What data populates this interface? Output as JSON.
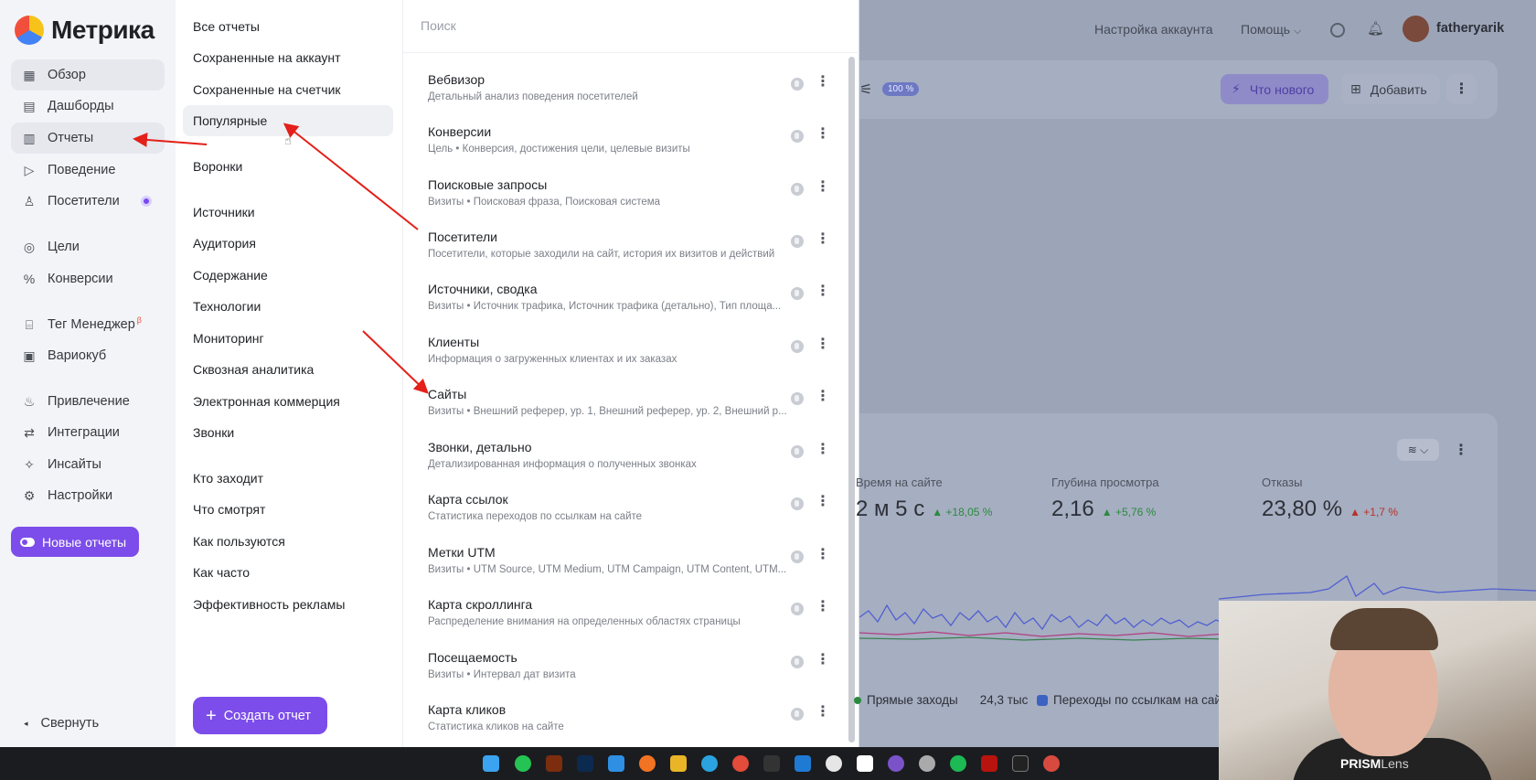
{
  "logo": {
    "text": "Метрика"
  },
  "leftnav": {
    "items": [
      {
        "label": "Обзор",
        "icon": "grid-icon"
      },
      {
        "label": "Дашборды",
        "icon": "dashboard-icon"
      },
      {
        "label": "Отчеты",
        "icon": "bar-chart-icon"
      },
      {
        "label": "Поведение",
        "icon": "play-icon"
      },
      {
        "label": "Посетители",
        "icon": "user-icon"
      },
      {
        "label": "Цели",
        "icon": "target-icon"
      },
      {
        "label": "Конверсии",
        "icon": "percent-icon"
      },
      {
        "label": "Тег Менеджер",
        "icon": "tag-icon",
        "badge": "β"
      },
      {
        "label": "Вариокуб",
        "icon": "cube-icon"
      },
      {
        "label": "Привлечение",
        "icon": "fire-icon"
      },
      {
        "label": "Интеграции",
        "icon": "integrations-icon"
      },
      {
        "label": "Инсайты",
        "icon": "sparkle-icon"
      },
      {
        "label": "Настройки",
        "icon": "gear-icon"
      }
    ],
    "new_reports": "Новые отчеты",
    "collapse": "Свернуть"
  },
  "categories": {
    "items": [
      "Все отчеты",
      "Сохраненные на аккаунт",
      "Сохраненные на счетчик",
      "Популярные",
      "Воронки",
      "Источники",
      "Аудитория",
      "Содержание",
      "Технологии",
      "Мониторинг",
      "Сквозная аналитика",
      "Электронная коммерция",
      "Звонки",
      "Кто заходит",
      "Что смотрят",
      "Как пользуются",
      "Как часто",
      "Эффективность рекламы"
    ],
    "create_button": "Создать отчет"
  },
  "reports": {
    "search_placeholder": "Поиск",
    "items": [
      {
        "title": "Вебвизор",
        "desc": "Детальный анализ поведения посетителей"
      },
      {
        "title": "Конверсии",
        "desc": "Цель • Конверсия, достижения цели, целевые визиты"
      },
      {
        "title": "Поисковые запросы",
        "desc": "Визиты • Поисковая фраза, Поисковая система"
      },
      {
        "title": "Посетители",
        "desc": "Посетители, которые заходили на сайт, история их визитов и действий"
      },
      {
        "title": "Источники, сводка",
        "desc": "Визиты • Источник трафика, Источник трафика (детально), Тип площа..."
      },
      {
        "title": "Клиенты",
        "desc": "Информация о загруженных клиентах и их заказах"
      },
      {
        "title": "Сайты",
        "desc": "Визиты • Внешний реферер, ур. 1, Внешний реферер, ур. 2, Внешний р..."
      },
      {
        "title": "Звонки, детально",
        "desc": "Детализированная информация о полученных звонках"
      },
      {
        "title": "Карта ссылок",
        "desc": "Статистика переходов по ссылкам на сайте"
      },
      {
        "title": "Метки UTM",
        "desc": "Визиты • UTM Source, UTM Medium, UTM Campaign, UTM Content, UTM..."
      },
      {
        "title": "Карта скроллинга",
        "desc": "Распределение внимания на определенных областях страницы"
      },
      {
        "title": "Посещаемость",
        "desc": "Визиты • Интервал дат визита"
      },
      {
        "title": "Карта кликов",
        "desc": "Статистика кликов на сайте"
      }
    ]
  },
  "topbar": {
    "account_settings": "Настройка аккаунта",
    "help": "Помощь",
    "username": "fatheryarik"
  },
  "toolbar": {
    "chip": "100 %",
    "whats_new": "Что нового",
    "add": "Добавить"
  },
  "metrics": [
    {
      "label": "Время на сайте",
      "value": "2 м 5 с",
      "delta": "▲ +18,05 %",
      "dir": "up"
    },
    {
      "label": "Глубина просмотра",
      "value": "2,16",
      "delta": "▲ +5,76 %",
      "dir": "up"
    },
    {
      "label": "Отказы",
      "value": "23,80 %",
      "delta": "▲ +1,7 %",
      "dir": "down"
    }
  ],
  "legend": {
    "direct": "Прямые заходы",
    "direct_value": "24,3 тыс",
    "links": "Переходы по ссылкам на сай"
  },
  "webcam": {
    "brand": "PRISM",
    "brand_suffix": "Lens"
  },
  "colors": {
    "accent": "#7c4dea",
    "annotation_arrow": "#e32019"
  }
}
